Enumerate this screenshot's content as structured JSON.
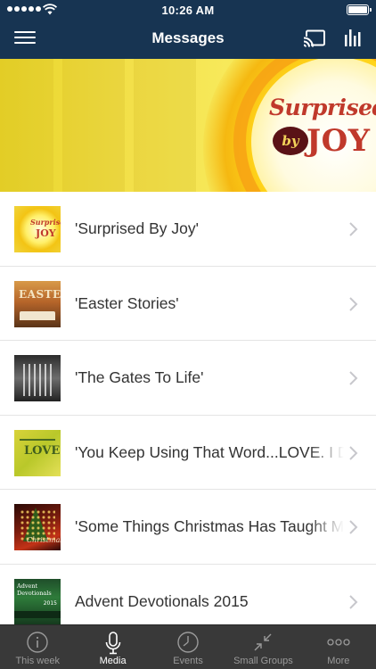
{
  "status_bar": {
    "time": "10:26 AM"
  },
  "nav": {
    "title": "Messages",
    "icons": [
      "menu-icon",
      "cast-icon",
      "stats-icon"
    ]
  },
  "banner": {
    "logo_top": "Surprised",
    "logo_by": "by",
    "logo_joy": "JOY"
  },
  "messages": [
    {
      "title": "'Surprised By Joy'",
      "thumb_text": "Surprised",
      "thumb_text2": "JOY"
    },
    {
      "title": "'Easter Stories'",
      "thumb_text": "EASTER"
    },
    {
      "title": "'The Gates To Life'"
    },
    {
      "title": "'You Keep Using That Word...LOVE. I Do",
      "thumb_text": "LOVE"
    },
    {
      "title": "'Some Things Christmas Has Taught Me",
      "thumb_text": "Christmas"
    },
    {
      "title": "Advent Devotionals 2015",
      "thumb_text": "Advent Devotionals",
      "thumb_year": "2015"
    }
  ],
  "tabs": [
    {
      "label": "This week",
      "icon": "info-icon",
      "active": false
    },
    {
      "label": "Media",
      "icon": "microphone-icon",
      "active": true
    },
    {
      "label": "Events",
      "icon": "clock-icon",
      "active": false
    },
    {
      "label": "Small Groups",
      "icon": "compress-arrows-icon",
      "active": false
    },
    {
      "label": "More",
      "icon": "more-dots-icon",
      "active": false
    }
  ],
  "colors": {
    "nav_bg": "#173452",
    "tab_bg": "#393939",
    "banner_yellow": "#f3e04a",
    "logo_red": "#c0392b"
  }
}
